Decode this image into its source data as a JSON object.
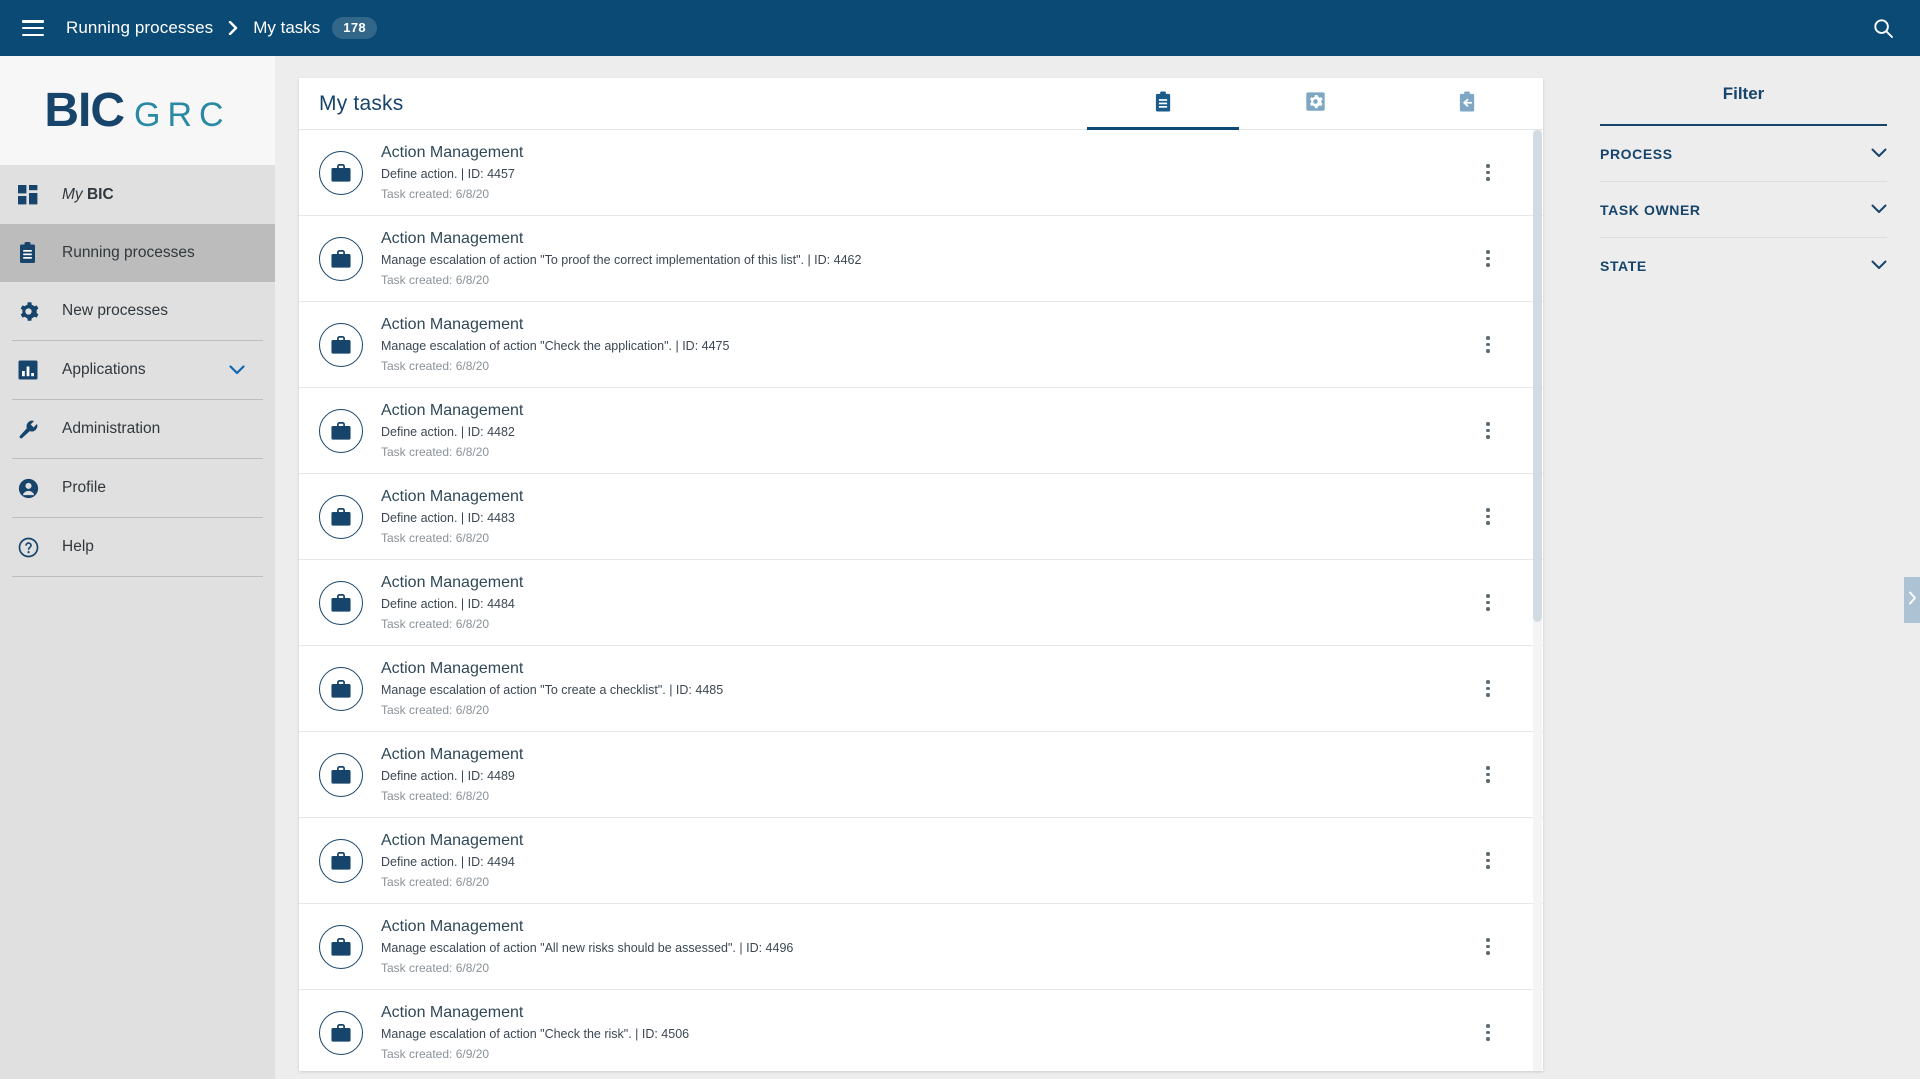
{
  "topbar": {
    "menu_icon": "hamburger-icon",
    "breadcrumb_parent": "Running processes",
    "breadcrumb_separator_icon": "chevron-right-icon",
    "breadcrumb_current": "My tasks",
    "badge_count": "178",
    "search_icon": "search-icon",
    "background_color": "#0b4a74"
  },
  "sidebar": {
    "logo": {
      "primary": "BIC",
      "secondary": "GRC",
      "primary_color": "#17446b",
      "secondary_color": "#2a8aa4"
    },
    "items": [
      {
        "label_italic": "My",
        "label_bold": "BIC",
        "icon": "grid-dashboard-icon",
        "active": false,
        "has_chevron": false
      },
      {
        "label": "Running processes",
        "icon": "clipboard-icon",
        "active": true,
        "has_chevron": false
      },
      {
        "label": "New processes",
        "icon": "gear-icon",
        "active": false,
        "has_chevron": false
      },
      {
        "label": "Applications",
        "icon": "bar-chart-icon",
        "active": false,
        "has_chevron": true
      },
      {
        "label": "Administration",
        "icon": "wrench-icon",
        "active": false,
        "has_chevron": false
      },
      {
        "label": "Profile",
        "icon": "user-circle-icon",
        "active": false,
        "has_chevron": false
      },
      {
        "label": "Help",
        "icon": "help-circle-icon",
        "active": false,
        "has_chevron": false
      }
    ]
  },
  "main": {
    "title": "My tasks",
    "tabs": [
      {
        "icon": "clipboard-tasks-icon",
        "active": true
      },
      {
        "icon": "gear-settings-icon",
        "active": false
      },
      {
        "icon": "clipboard-arrow-icon",
        "active": false
      }
    ],
    "row_menu_icon": "kebab-menu-icon",
    "row_avatar_icon": "briefcase-icon",
    "tasks": [
      {
        "title": "Action Management",
        "subtitle": "Define action. | ID: 4457",
        "meta": "Task created: 6/8/20"
      },
      {
        "title": "Action Management",
        "subtitle": "Manage escalation of action \"To proof the correct implementation of this list\". | ID: 4462",
        "meta": "Task created: 6/8/20"
      },
      {
        "title": "Action Management",
        "subtitle": "Manage escalation of action \"Check the application\". | ID: 4475",
        "meta": "Task created: 6/8/20"
      },
      {
        "title": "Action Management",
        "subtitle": "Define action. | ID: 4482",
        "meta": "Task created: 6/8/20"
      },
      {
        "title": "Action Management",
        "subtitle": "Define action. | ID: 4483",
        "meta": "Task created: 6/8/20"
      },
      {
        "title": "Action Management",
        "subtitle": "Define action. | ID: 4484",
        "meta": "Task created: 6/8/20"
      },
      {
        "title": "Action Management",
        "subtitle": "Manage escalation of action \"To create a checklist\". | ID: 4485",
        "meta": "Task created: 6/8/20"
      },
      {
        "title": "Action Management",
        "subtitle": "Define action. | ID: 4489",
        "meta": "Task created: 6/8/20"
      },
      {
        "title": "Action Management",
        "subtitle": "Define action. | ID: 4494",
        "meta": "Task created: 6/8/20"
      },
      {
        "title": "Action Management",
        "subtitle": "Manage escalation of action \"All new risks should be assessed\". | ID: 4496",
        "meta": "Task created: 6/8/20"
      },
      {
        "title": "Action Management",
        "subtitle": "Manage escalation of action \"Check the risk\". | ID: 4506",
        "meta": "Task created: 6/9/20"
      }
    ]
  },
  "filter": {
    "title": "Filter",
    "groups": [
      {
        "label": "PROCESS",
        "icon": "chevron-down-icon"
      },
      {
        "label": "TASK OWNER",
        "icon": "chevron-down-icon"
      },
      {
        "label": "STATE",
        "icon": "chevron-down-icon"
      }
    ],
    "collapse_handle_icon": "chevron-right-icon"
  }
}
